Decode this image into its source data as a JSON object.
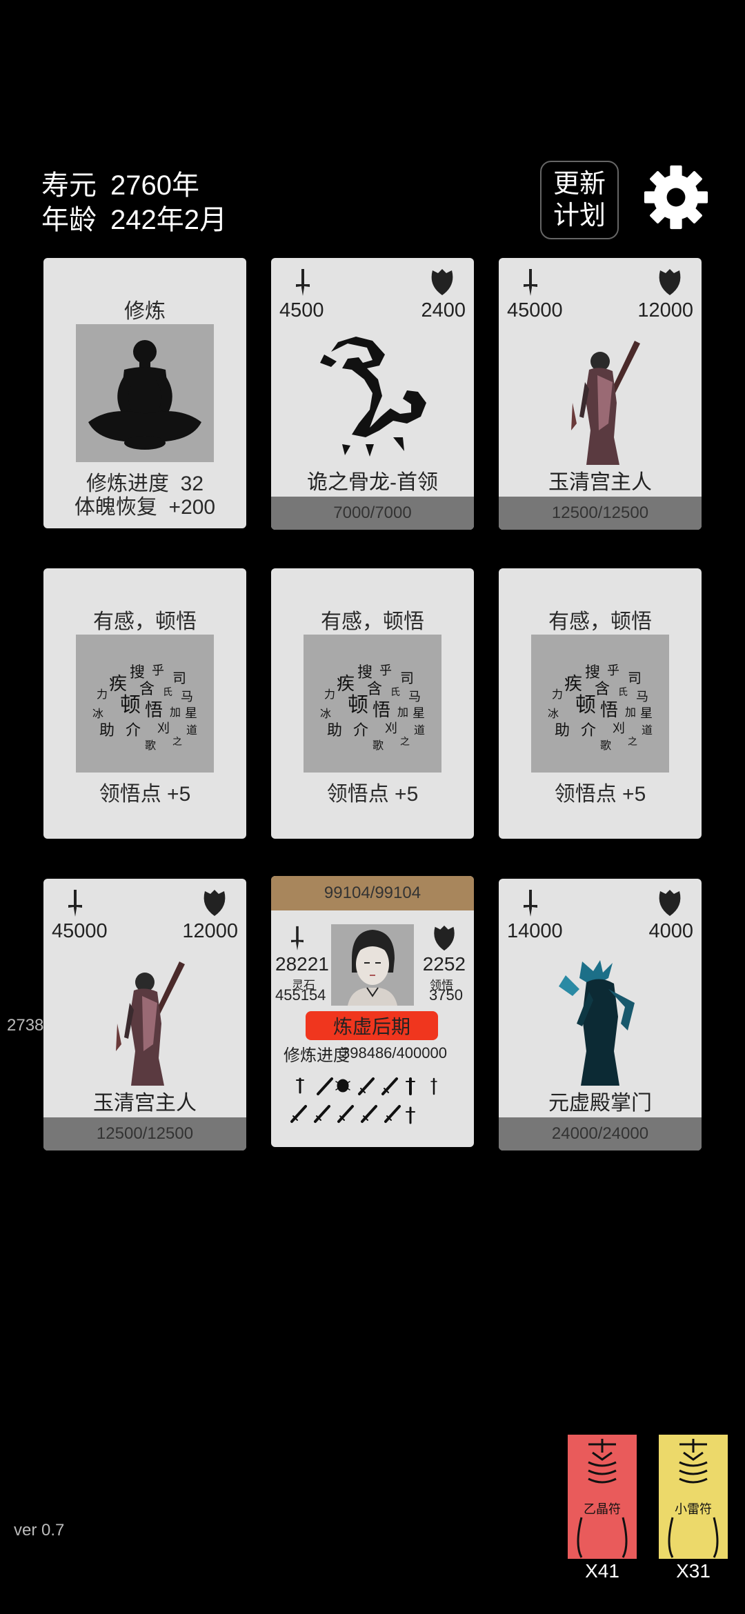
{
  "header": {
    "lifespan_label": "寿元",
    "lifespan_value": "2760年",
    "age_label": "年龄",
    "age_value": "242年2月",
    "plan_button_label": "更新\n计划"
  },
  "cards": {
    "cultivate": {
      "title": "修炼",
      "progress_label": "修炼进度",
      "progress_value": "32",
      "recovery_label": "体魄恢复",
      "recovery_value": "+200"
    },
    "enemy_dragon": {
      "atk": "4500",
      "def": "2400",
      "name": "诡之骨龙-首领",
      "hp": "7000/7000"
    },
    "enemy_yuqing_1": {
      "atk": "45000",
      "def": "12000",
      "name": "玉清宫主人",
      "hp": "12500/12500"
    },
    "insight_1": {
      "title": "有感，顿悟",
      "reward": "领悟点  +5"
    },
    "insight_2": {
      "title": "有感，顿悟",
      "reward": "领悟点  +5"
    },
    "insight_3": {
      "title": "有感，顿悟",
      "reward": "领悟点  +5"
    },
    "enemy_yuqing_2": {
      "atk": "45000",
      "def": "12000",
      "name": "玉清宫主人",
      "hp": "12500/12500"
    },
    "enemy_yuanxu": {
      "atk": "14000",
      "def": "4000",
      "name": "元虚殿掌门",
      "hp": "24000/24000"
    }
  },
  "player": {
    "hp": "99104/99104",
    "atk": "28221",
    "def": "2252",
    "spirit_stone_label": "灵石",
    "spirit_stone_value": "455154",
    "insight_label": "领悟",
    "insight_value": "3750",
    "realm": "炼虚后期",
    "progress_label": "修炼进度",
    "progress_value": "398486/400000"
  },
  "side_number": "2738",
  "talismans": [
    {
      "name": "乙晶符",
      "count": "X41",
      "color": "#e95b5b"
    },
    {
      "name": "小雷符",
      "count": "X31",
      "color": "#ecd96a"
    }
  ],
  "version": "ver 0.7",
  "colors": {
    "card_bg": "#e3e3e3",
    "hp_bar": "#777777",
    "player_hp_bar": "#a8865c",
    "realm_badge": "#f0361e"
  }
}
